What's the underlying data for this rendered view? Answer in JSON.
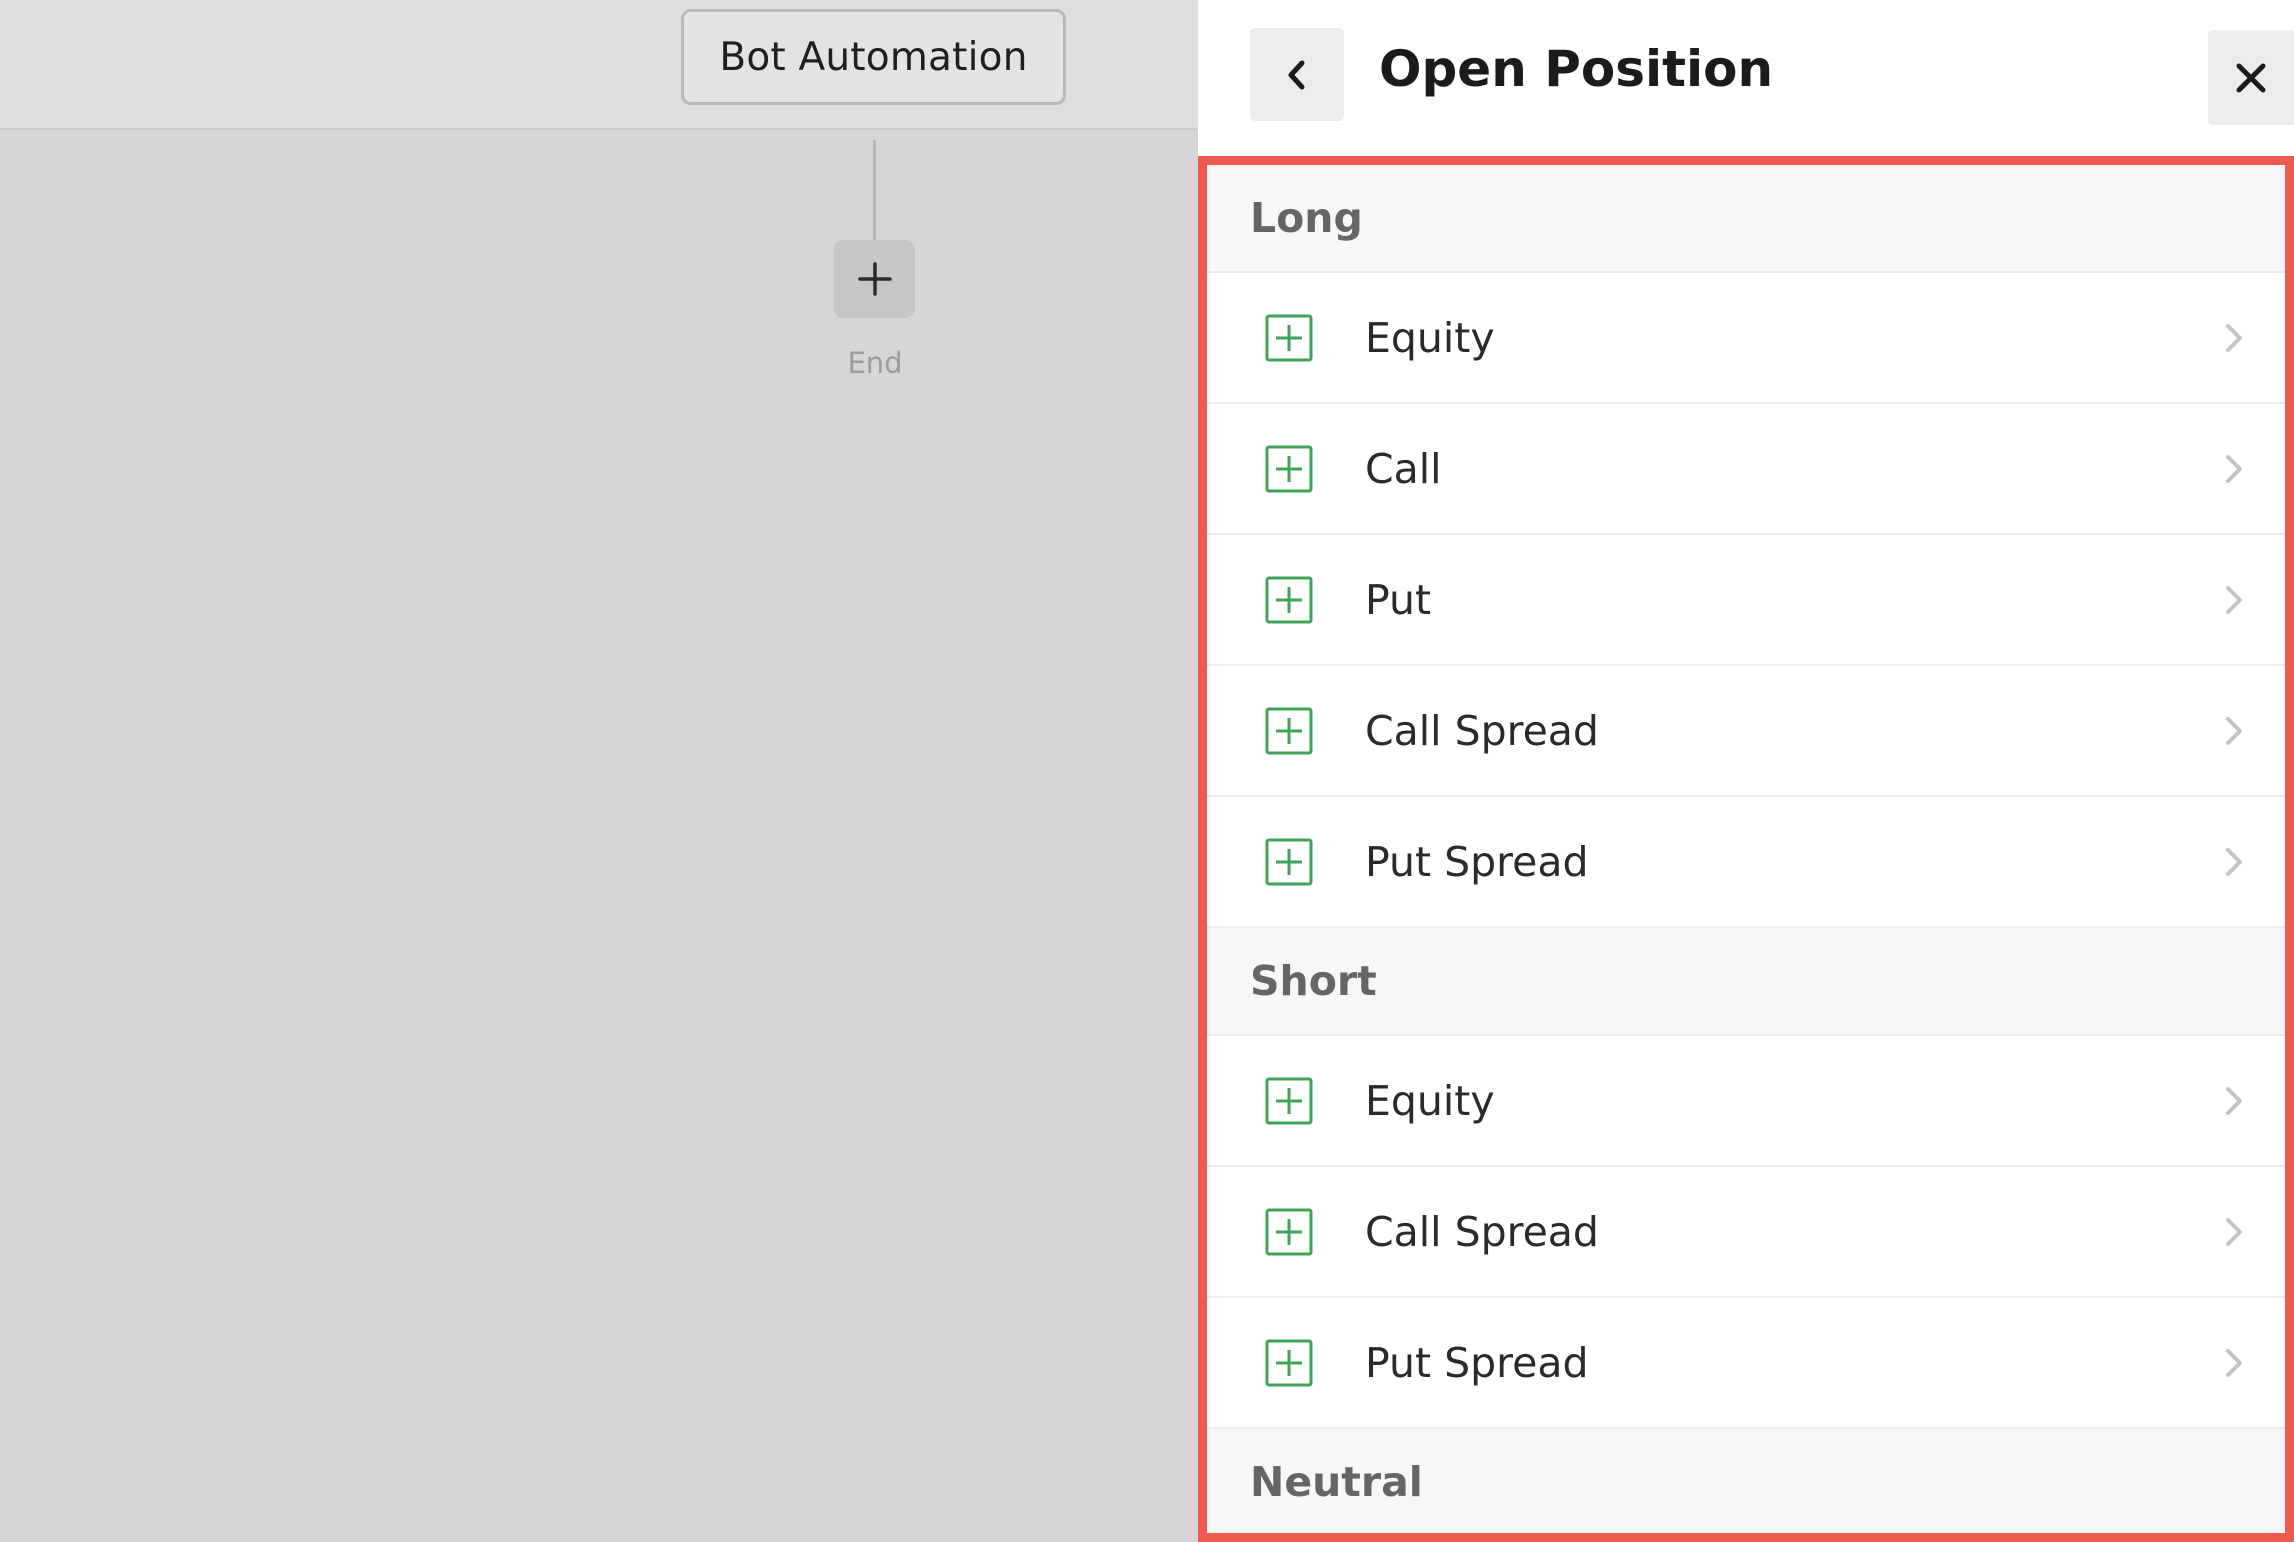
{
  "canvas": {
    "node_label": "Bot Automation",
    "add_icon": "plus-icon",
    "end_label": "End"
  },
  "panel": {
    "title": "Open Position",
    "back_icon": "chevron-left-icon",
    "close_icon": "close-icon",
    "sections": [
      {
        "title": "Long",
        "items": [
          {
            "label": "Equity"
          },
          {
            "label": "Call"
          },
          {
            "label": "Put"
          },
          {
            "label": "Call Spread"
          },
          {
            "label": "Put Spread"
          }
        ]
      },
      {
        "title": "Short",
        "items": [
          {
            "label": "Equity"
          },
          {
            "label": "Call Spread"
          },
          {
            "label": "Put Spread"
          }
        ]
      },
      {
        "title": "Neutral",
        "items": []
      }
    ]
  },
  "colors": {
    "accent_green": "#3fa35a",
    "highlight_border": "#ef5a50",
    "chevron": "#c4c4c7"
  }
}
